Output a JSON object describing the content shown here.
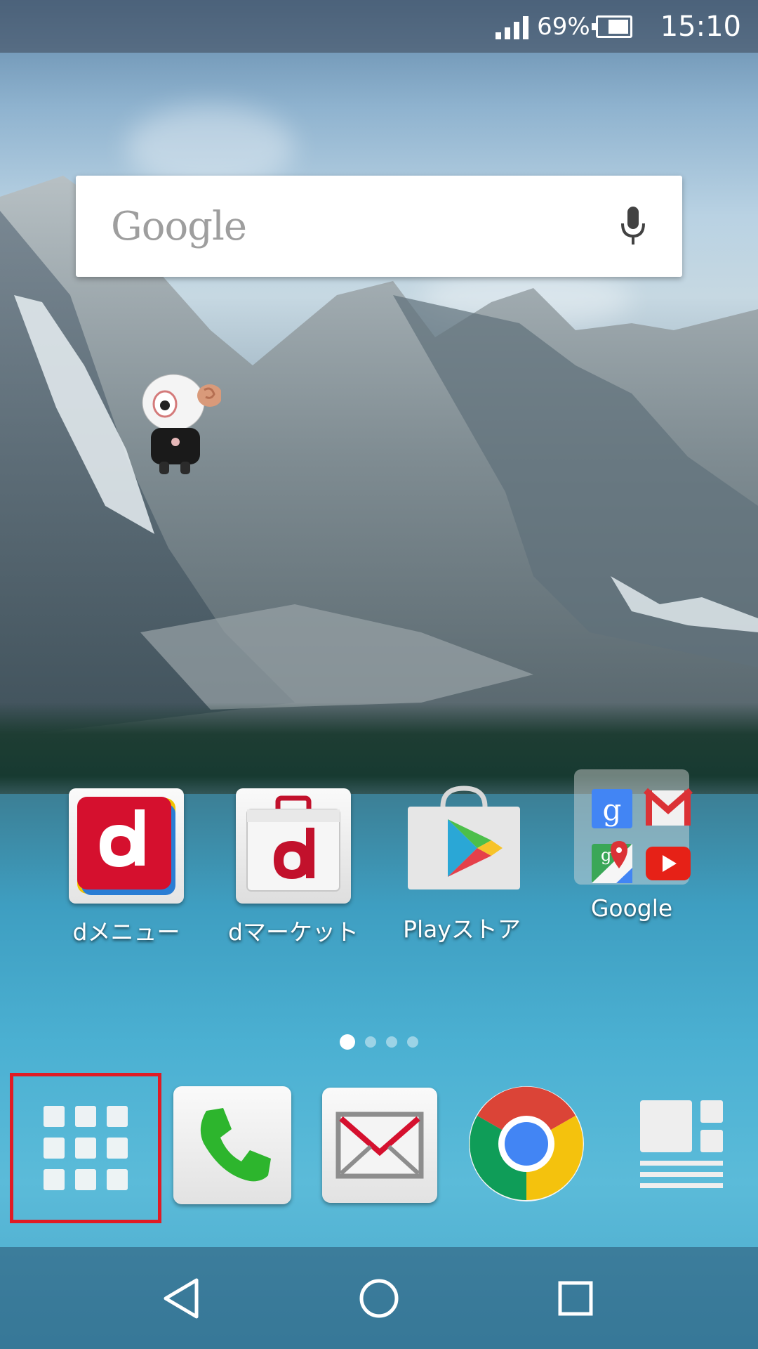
{
  "status_bar": {
    "battery_percent": "69%",
    "battery_level": 0.69,
    "time": "15:10",
    "signal_icon": "cell-signal-icon",
    "battery_icon": "battery-icon"
  },
  "search": {
    "logo_text": "Google",
    "mic_icon": "mic-icon"
  },
  "home_apps": [
    {
      "label": "dメニュー",
      "icon": "d-menu-icon"
    },
    {
      "label": "dマーケット",
      "icon": "d-market-icon"
    },
    {
      "label": "Playストア",
      "icon": "play-store-icon"
    },
    {
      "label": "Google",
      "icon": "google-folder-icon"
    }
  ],
  "folder_apps": [
    "google-search-icon",
    "gmail-icon",
    "maps-icon",
    "youtube-icon"
  ],
  "page_indicator": {
    "current": 1,
    "total": 4
  },
  "dock": [
    {
      "name": "app-drawer",
      "icon": "app-grid-icon",
      "highlighted": true
    },
    {
      "name": "phone",
      "icon": "phone-icon"
    },
    {
      "name": "mail",
      "icon": "mail-icon"
    },
    {
      "name": "chrome",
      "icon": "chrome-icon"
    },
    {
      "name": "widget-app",
      "icon": "layout-icon"
    }
  ],
  "nav": {
    "back_icon": "back-icon",
    "home_icon": "home-icon",
    "recents_icon": "recents-icon"
  },
  "colors": {
    "highlight": "#e01b24",
    "docomo_red": "#d5102e",
    "phone_green": "#2db52d"
  }
}
